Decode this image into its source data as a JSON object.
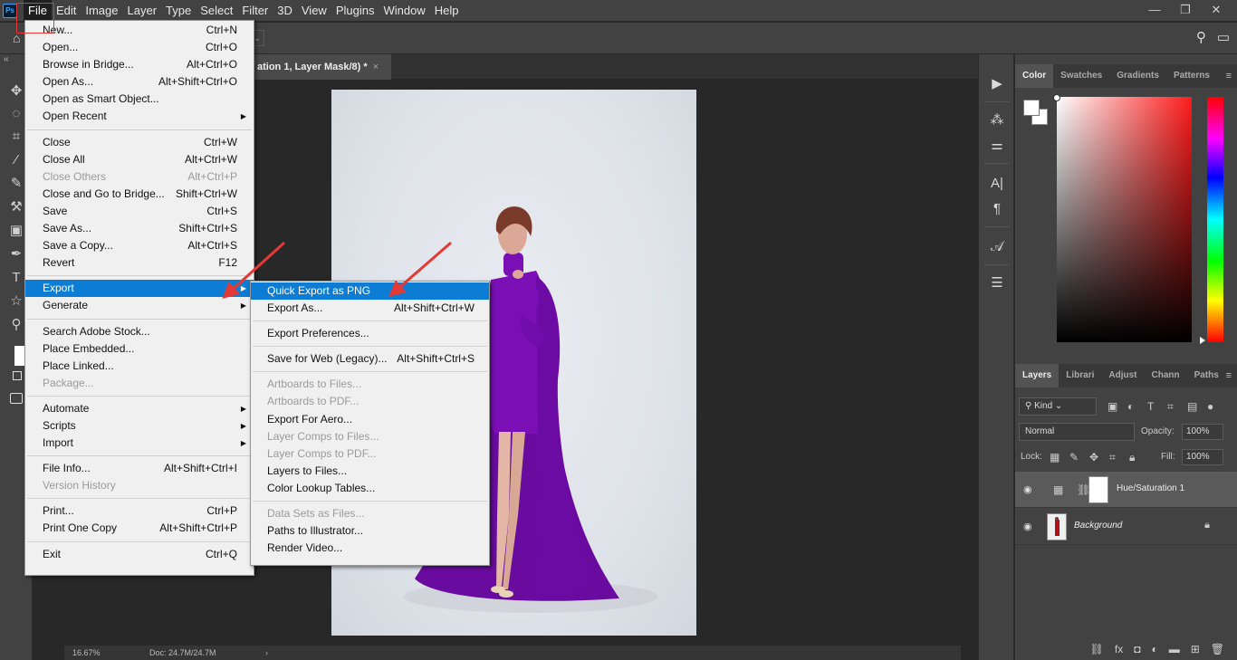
{
  "app": {
    "logo": "Ps"
  },
  "menubar": {
    "items": [
      "File",
      "Edit",
      "Image",
      "Layer",
      "Type",
      "Select",
      "Filter",
      "3D",
      "View",
      "Plugins",
      "Window",
      "Help"
    ],
    "window_controls": [
      "—",
      "❐",
      "✕"
    ]
  },
  "document": {
    "tab_title": "ation 1, Layer Mask/8) *",
    "close": "×",
    "zoom": "16.67%",
    "doc_info": "Doc: 24.7M/24.7M",
    "status_arrow": "›"
  },
  "file_menu": {
    "items": [
      {
        "label": "New...",
        "shortcut": "Ctrl+N"
      },
      {
        "label": "Open...",
        "shortcut": "Ctrl+O"
      },
      {
        "label": "Browse in Bridge...",
        "shortcut": "Alt+Ctrl+O"
      },
      {
        "label": "Open As...",
        "shortcut": "Alt+Shift+Ctrl+O"
      },
      {
        "label": "Open as Smart Object...",
        "shortcut": ""
      },
      {
        "label": "Open Recent",
        "shortcut": ""
      },
      {
        "label": "Close",
        "shortcut": "Ctrl+W"
      },
      {
        "label": "Close All",
        "shortcut": "Alt+Ctrl+W"
      },
      {
        "label": "Close Others",
        "shortcut": "Alt+Ctrl+P"
      },
      {
        "label": "Close and Go to Bridge...",
        "shortcut": "Shift+Ctrl+W"
      },
      {
        "label": "Save",
        "shortcut": "Ctrl+S"
      },
      {
        "label": "Save As...",
        "shortcut": "Shift+Ctrl+S"
      },
      {
        "label": "Save a Copy...",
        "shortcut": "Alt+Ctrl+S"
      },
      {
        "label": "Revert",
        "shortcut": "F12"
      },
      {
        "label": "Export",
        "shortcut": ""
      },
      {
        "label": "Generate",
        "shortcut": ""
      },
      {
        "label": "Search Adobe Stock...",
        "shortcut": ""
      },
      {
        "label": "Place Embedded...",
        "shortcut": ""
      },
      {
        "label": "Place Linked...",
        "shortcut": ""
      },
      {
        "label": "Package...",
        "shortcut": ""
      },
      {
        "label": "Automate",
        "shortcut": ""
      },
      {
        "label": "Scripts",
        "shortcut": ""
      },
      {
        "label": "Import",
        "shortcut": ""
      },
      {
        "label": "File Info...",
        "shortcut": "Alt+Shift+Ctrl+I"
      },
      {
        "label": "Version History",
        "shortcut": ""
      },
      {
        "label": "Print...",
        "shortcut": "Ctrl+P"
      },
      {
        "label": "Print One Copy",
        "shortcut": "Alt+Shift+Ctrl+P"
      },
      {
        "label": "Exit",
        "shortcut": "Ctrl+Q"
      }
    ]
  },
  "export_menu": {
    "items": [
      {
        "label": "Quick Export as PNG",
        "shortcut": ""
      },
      {
        "label": "Export As...",
        "shortcut": "Alt+Shift+Ctrl+W"
      },
      {
        "label": "Export Preferences...",
        "shortcut": ""
      },
      {
        "label": "Save for Web (Legacy)...",
        "shortcut": "Alt+Shift+Ctrl+S"
      },
      {
        "label": "Artboards to Files...",
        "shortcut": ""
      },
      {
        "label": "Artboards to PDF...",
        "shortcut": ""
      },
      {
        "label": "Export For Aero...",
        "shortcut": ""
      },
      {
        "label": "Layer Comps to Files...",
        "shortcut": ""
      },
      {
        "label": "Layer Comps to PDF...",
        "shortcut": ""
      },
      {
        "label": "Layers to Files...",
        "shortcut": ""
      },
      {
        "label": "Color Lookup Tables...",
        "shortcut": ""
      },
      {
        "label": "Data Sets as Files...",
        "shortcut": ""
      },
      {
        "label": "Paths to Illustrator...",
        "shortcut": ""
      },
      {
        "label": "Render Video...",
        "shortcut": ""
      }
    ]
  },
  "color_panel": {
    "tabs": [
      "Color",
      "Swatches",
      "Gradients",
      "Patterns"
    ],
    "menu": "≡"
  },
  "layers_panel": {
    "tabs": [
      "Layers",
      "Librari",
      "Adjust",
      "Chann",
      "Paths"
    ],
    "menu": "≡",
    "kind": "Kind",
    "blend_mode": "Normal",
    "opacity_label": "Opacity:",
    "opacity": "100%",
    "lock_label": "Lock:",
    "fill_label": "Fill:",
    "fill": "100%",
    "layers": [
      {
        "name": "Hue/Saturation 1"
      },
      {
        "name": "Background"
      }
    ]
  },
  "colors": {
    "accent": "#0c7cd5",
    "annotation": "#e53935",
    "dress": "#7a0fb6"
  }
}
